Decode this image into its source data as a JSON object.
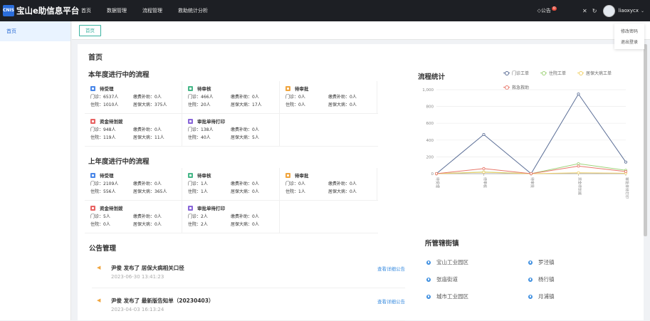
{
  "app": {
    "logo_badge": "CNIS",
    "title": "宝山e助信息平台"
  },
  "nav": [
    "首页",
    "数据管理",
    "流程管理",
    "救助统计分析"
  ],
  "header": {
    "notice_label": "公告",
    "notice_count": "0",
    "username": "liaoxycx"
  },
  "user_menu": [
    "修改密码",
    "退出登录"
  ],
  "sidebar": {
    "items": [
      "首页"
    ]
  },
  "tabs": [
    "首页"
  ],
  "page": {
    "title": "首页"
  },
  "current_year": {
    "title": "本年度进行中的流程",
    "cards": [
      {
        "name": "待受理",
        "color": "blue",
        "clinic": "门诊：6537人",
        "subsidy": "缴费补助：0人",
        "inpatient": "住院：1010人",
        "serious": "居保大病：375人"
      },
      {
        "name": "待审核",
        "color": "green",
        "clinic": "门诊：466人",
        "subsidy": "缴费补助：0人",
        "inpatient": "住院：20人",
        "serious": "居保大病：17人"
      },
      {
        "name": "待审批",
        "color": "orange",
        "clinic": "门诊：0人",
        "subsidy": "缴费补助：0人",
        "inpatient": "住院：0人",
        "serious": "居保大病：0人"
      },
      {
        "name": "资金待划拨",
        "color": "red",
        "clinic": "门诊：948人",
        "subsidy": "缴费补助：0人",
        "inpatient": "住院：119人",
        "serious": "居保大病：11人"
      },
      {
        "name": "审批单待打印",
        "color": "purple",
        "clinic": "门诊：138人",
        "subsidy": "缴费补助：0人",
        "inpatient": "住院：40人",
        "serious": "居保大病：5人"
      }
    ]
  },
  "last_year": {
    "title": "上年度进行中的流程",
    "cards": [
      {
        "name": "待受理",
        "color": "blue",
        "clinic": "门诊：2109人",
        "subsidy": "缴费补助：0人",
        "inpatient": "住院：556人",
        "serious": "居保大病：365人"
      },
      {
        "name": "待审核",
        "color": "green",
        "clinic": "门诊：1人",
        "subsidy": "缴费补助：0人",
        "inpatient": "住院：1人",
        "serious": "居保大病：0人"
      },
      {
        "name": "待审批",
        "color": "orange",
        "clinic": "门诊：0人",
        "subsidy": "缴费补助：0人",
        "inpatient": "住院：1人",
        "serious": "居保大病：0人"
      },
      {
        "name": "资金待划拨",
        "color": "red",
        "clinic": "门诊：5人",
        "subsidy": "缴费补助：0人",
        "inpatient": "住院：0人",
        "serious": "居保大病：0人"
      },
      {
        "name": "审批单待打印",
        "color": "purple",
        "clinic": "门诊：2人",
        "subsidy": "缴费补助：0人",
        "inpatient": "住院：2人",
        "serious": "居保大病：0人"
      }
    ]
  },
  "chart_data": {
    "type": "line",
    "title": "流程统计",
    "categories": [
      "待受理",
      "待审核",
      "待审批",
      "资金待划拨",
      "审批单待打印"
    ],
    "yticks": [
      0,
      200,
      400,
      600,
      800,
      "1,000"
    ],
    "ylim": [
      0,
      1000
    ],
    "grid": true,
    "legend_position": "top-right",
    "series": [
      {
        "name": "门诊工单",
        "color": "#5b6e96",
        "values": [
          0,
          466,
          0,
          948,
          138
        ]
      },
      {
        "name": "住院工单",
        "color": "#9fd37a",
        "values": [
          0,
          20,
          0,
          119,
          40
        ]
      },
      {
        "name": "居保大病工单",
        "color": "#f2d26b",
        "values": [
          0,
          17,
          0,
          11,
          5
        ]
      },
      {
        "name": "救急救助",
        "color": "#e8776a",
        "values": [
          0,
          60,
          0,
          90,
          25
        ]
      }
    ]
  },
  "announcements": {
    "title": "公告管理",
    "items": [
      {
        "title": "尹俊 发布了 居保大病相关口径",
        "time": "2023-06-30 13:41:23",
        "link": "查看详细公告"
      },
      {
        "title": "尹俊 发布了 最新版告知单（20230403）",
        "time": "2023-04-03 16:13:24",
        "link": "查看详细公告"
      }
    ]
  },
  "towns": {
    "title": "所管辖街镇",
    "items": [
      "宝山工业园区",
      "罗泾镇",
      "张庙街道",
      "杨行镇",
      "城市工业园区",
      "月浦镇"
    ]
  }
}
